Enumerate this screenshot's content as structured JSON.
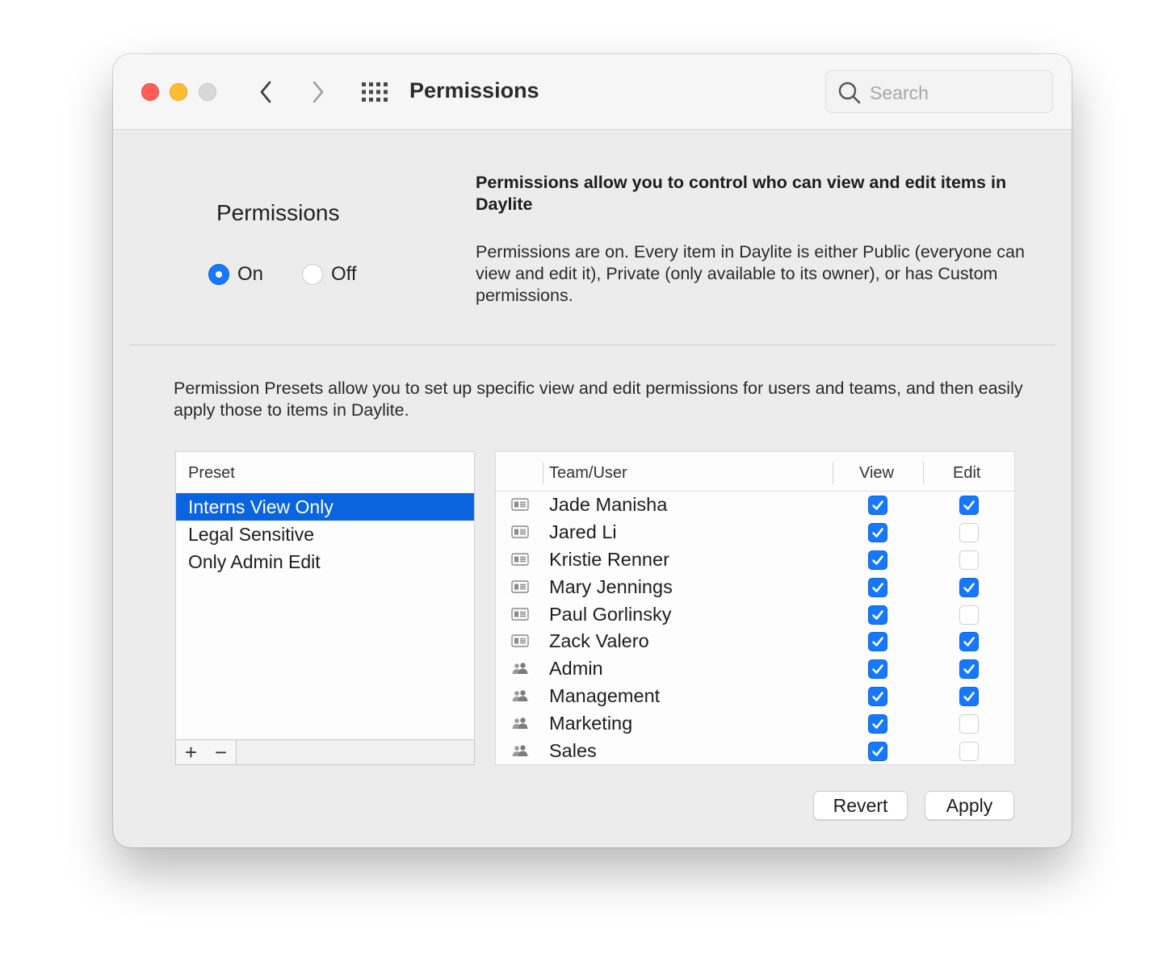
{
  "window": {
    "title": "Permissions",
    "search_placeholder": "Search"
  },
  "permissions": {
    "heading": "Permissions",
    "on_label": "On",
    "off_label": "Off",
    "selected": "on",
    "description_title": "Permissions allow you to control who can view and edit items in Daylite",
    "description_body": "Permissions are on. Every item in Daylite is either Public (everyone can view and edit it), Private (only available to its owner), or has Custom permissions."
  },
  "presets": {
    "intro": "Permission Presets allow you to set up specific view and edit permissions for users and teams, and then easily apply those to items in Daylite.",
    "header": "Preset",
    "items": [
      "Interns View Only",
      "Legal Sensitive",
      "Only Admin Edit"
    ],
    "selected_index": 0,
    "add_label": "+",
    "remove_label": "−"
  },
  "table": {
    "headers": {
      "team_user": "Team/User",
      "view": "View",
      "edit": "Edit"
    },
    "rows": [
      {
        "type": "user",
        "name": "Jade Manisha",
        "view": true,
        "edit": true
      },
      {
        "type": "user",
        "name": "Jared Li",
        "view": true,
        "edit": false
      },
      {
        "type": "user",
        "name": "Kristie Renner",
        "view": true,
        "edit": false
      },
      {
        "type": "user",
        "name": "Mary Jennings",
        "view": true,
        "edit": true
      },
      {
        "type": "user",
        "name": "Paul Gorlinsky",
        "view": true,
        "edit": false
      },
      {
        "type": "user",
        "name": "Zack Valero",
        "view": true,
        "edit": true
      },
      {
        "type": "team",
        "name": "Admin",
        "view": true,
        "edit": true
      },
      {
        "type": "team",
        "name": "Management",
        "view": true,
        "edit": true
      },
      {
        "type": "team",
        "name": "Marketing",
        "view": true,
        "edit": false
      },
      {
        "type": "team",
        "name": "Sales",
        "view": true,
        "edit": false
      }
    ]
  },
  "buttons": {
    "revert": "Revert",
    "apply": "Apply"
  },
  "icons": {
    "user": "contact-card-icon",
    "team": "team-icon",
    "back": "chevron-left-icon",
    "forward": "chevron-right-icon",
    "grid": "grid-icon",
    "search": "search-icon"
  },
  "colors": {
    "accent": "#1677ff",
    "selection": "#0a64e0",
    "close": "#ff5f57",
    "minimize": "#febc2e"
  }
}
